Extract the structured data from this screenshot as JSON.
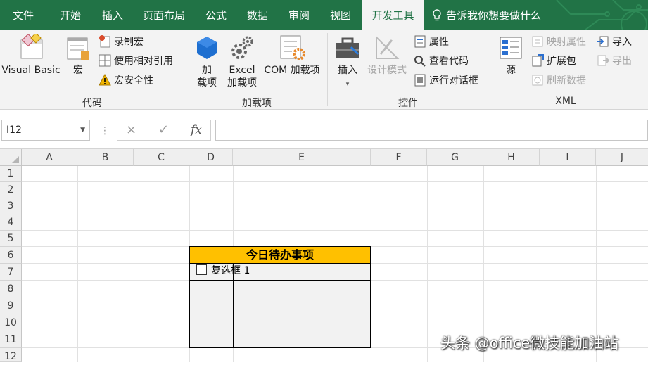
{
  "tabs": [
    {
      "label": "文件"
    },
    {
      "label": "开始"
    },
    {
      "label": "插入"
    },
    {
      "label": "页面布局"
    },
    {
      "label": "公式"
    },
    {
      "label": "数据"
    },
    {
      "label": "审阅"
    },
    {
      "label": "视图"
    },
    {
      "label": "开发工具"
    }
  ],
  "active_tab": "开发工具",
  "tell_me": "告诉我你想要做什么",
  "ribbon": {
    "code": {
      "visual_basic": "Visual Basic",
      "macros": "宏",
      "record_macro": "录制宏",
      "relative_refs": "使用相对引用",
      "macro_security": "宏安全性",
      "label": "代码"
    },
    "addins": {
      "addins_line1": "加",
      "addins_line2": "载项",
      "excel_addins_line1": "Excel",
      "excel_addins_line2": "加载项",
      "com_addins": "COM 加载项",
      "label": "加载项"
    },
    "controls": {
      "insert": "插入",
      "design_mode": "设计模式",
      "properties": "属性",
      "view_code": "查看代码",
      "run_dialog": "运行对话框",
      "label": "控件"
    },
    "xml": {
      "source": "源",
      "map_properties": "映射属性",
      "expansion_packs": "扩展包",
      "refresh_data": "刷新数据",
      "import": "导入",
      "export": "导出",
      "label": "XML"
    }
  },
  "formula_bar": {
    "name_box": "I12",
    "cancel_icon": "×",
    "enter_icon": "✓",
    "fx": "fx",
    "formula": ""
  },
  "columns": [
    "A",
    "B",
    "C",
    "D",
    "E",
    "F",
    "G",
    "H",
    "I",
    "J"
  ],
  "rows": [
    "1",
    "2",
    "3",
    "4",
    "5",
    "6",
    "7",
    "8",
    "9",
    "10",
    "11",
    "12"
  ],
  "sheet": {
    "table_title": "今日待办事项",
    "checkbox_label": "复选框 1"
  },
  "watermark": "头条 @office微技能加油站",
  "colors": {
    "brand": "#217346",
    "title_fill": "#FFC000",
    "cell_fill": "#F2F2F2"
  }
}
